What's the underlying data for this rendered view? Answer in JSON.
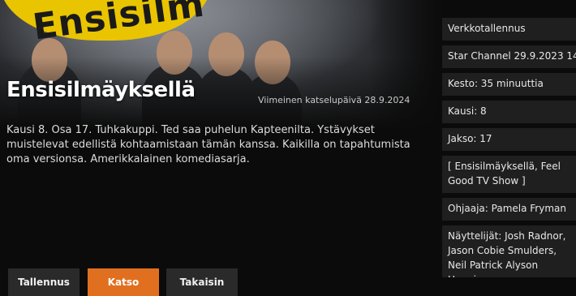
{
  "program": {
    "title": "Ensisilmäyksellä",
    "last_watch_date": "Viimeinen katselupäivä 28.9.2024",
    "description": "Kausi 8. Osa 17. Tuhkakuppi. Ted saa puhelun Kapteenilta. Ystävykset muistelevat edellistä kohtaamistaan tämän kanssa. Kaikilla on tapahtumista oma versionsa. Amerikkalainen komediasarja.",
    "hero_image_text": "Ensisilm"
  },
  "actions": {
    "record_label": "Tallennus",
    "watch_label": "Katso",
    "back_label": "Takaisin"
  },
  "info": {
    "recording_type": "Verkkotallennus",
    "channel_date": "Star Channel  29.9.2023  14",
    "duration": "Kesto: 35 minuuttia",
    "season": "Kausi: 8",
    "episode": "Jakso: 17",
    "categories": "[ Ensisilmäyksellä, Feel Good TV Show ]",
    "director": "Ohjaaja: Pamela Fryman",
    "actors": "Näyttelijät: Josh Radnor, Jason Cobie Smulders, Neil Patrick Alyson Hannigan"
  },
  "colors": {
    "accent": "#e0701f",
    "button_bg": "#2a2a2a",
    "panel_bg": "#1f1f1f",
    "background": "#0b0b0b"
  }
}
